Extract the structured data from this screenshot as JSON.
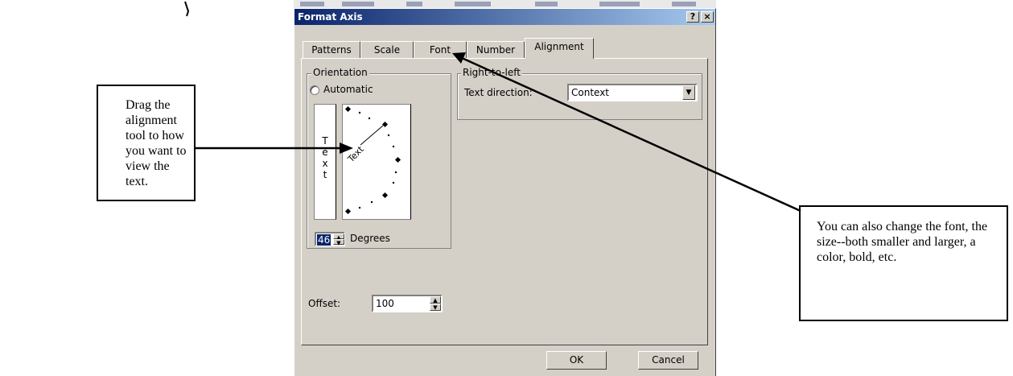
{
  "window": {
    "title": "Format Axis",
    "help_glyph": "?",
    "close_glyph": "×"
  },
  "tabs": [
    {
      "label": "Patterns"
    },
    {
      "label": "Scale"
    },
    {
      "label": "Font"
    },
    {
      "label": "Number"
    },
    {
      "label": "Alignment",
      "active": true
    }
  ],
  "orientation": {
    "group_label": "Orientation",
    "automatic_label": "Automatic",
    "automatic_checked": false,
    "vertical_text": [
      "T",
      "e",
      "x",
      "t"
    ],
    "dial_text": "Text",
    "degrees_value": "46",
    "degrees_label": "Degrees"
  },
  "right_to_left": {
    "group_label": "Right-to-left",
    "text_direction_label": "Text direction:",
    "text_direction_value": "Context"
  },
  "offset": {
    "label": "Offset:",
    "value": "100"
  },
  "buttons": {
    "ok": "OK",
    "cancel": "Cancel"
  },
  "callouts": {
    "left": "Drag the alignment tool to how you want to view the text.",
    "right": "You can also change the font, the size--both smaller and larger, a color, bold, etc."
  },
  "colors": {
    "titlebar_start": "#0a246a",
    "titlebar_end": "#a6caf0",
    "dialog_face": "#d4d0c8"
  }
}
